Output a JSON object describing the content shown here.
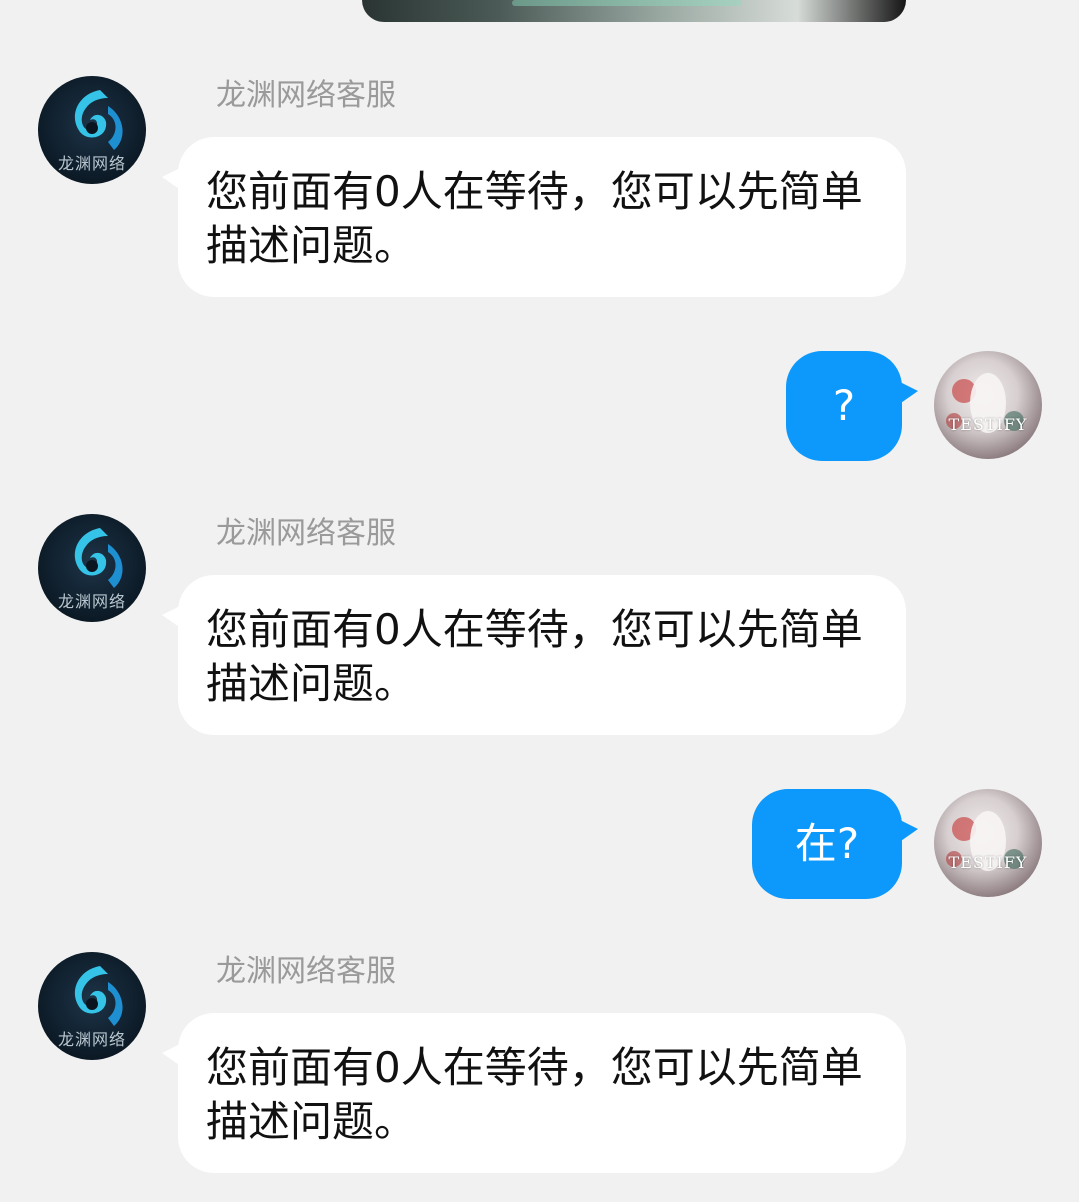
{
  "agent_name": "龙渊网络客服",
  "agent_logo_text": "龙渊网络",
  "user_avatar_text": "TESTIFY",
  "colors": {
    "background": "#f1f1f1",
    "agent_bubble": "#ffffff",
    "user_bubble": "#0d99fb",
    "sender_name": "#9a9a9a"
  },
  "messages": [
    {
      "from": "agent",
      "sender": "龙渊网络客服",
      "text": "您前面有0人在等待，您可以先简单描述问题。"
    },
    {
      "from": "user",
      "text": "?"
    },
    {
      "from": "agent",
      "sender": "龙渊网络客服",
      "text": "您前面有0人在等待，您可以先简单描述问题。"
    },
    {
      "from": "user",
      "text": "在?"
    },
    {
      "from": "agent",
      "sender": "龙渊网络客服",
      "text": "您前面有0人在等待，您可以先简单描述问题。"
    }
  ]
}
